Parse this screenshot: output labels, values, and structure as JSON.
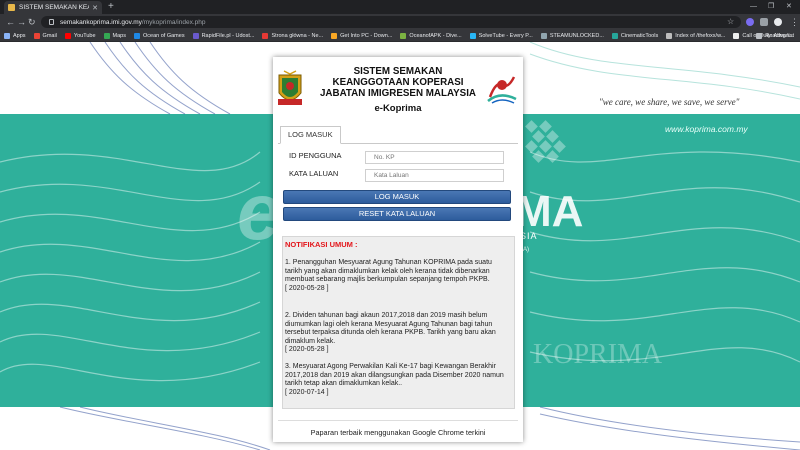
{
  "browser": {
    "tab_title": "SISTEM SEMAKAN KEANGGOTA...",
    "url_host": "semakankoprima.imi.gov.my",
    "url_path": "/mykoprima/index.php",
    "bookmarks": [
      "Apps",
      "Gmail",
      "YouTube",
      "Maps",
      "Ocean of Games",
      "RapidFile.pl - Udost...",
      "Strona główna - Ne...",
      "Get Into PC - Down...",
      "OceanofAPK - Dive...",
      "SolveTube - Every P...",
      "STEAMUNLOCKED...",
      "CinematicTools",
      "Index of /thefoxx/w...",
      "Call of Duty: Advan..."
    ],
    "reading_list": "Reading list"
  },
  "background": {
    "tagline": "\"we care, we share, we save, we serve\"",
    "site_url": "www.koprima.com.my"
  },
  "header": {
    "title_line1": "SISTEM SEMAKAN",
    "title_line2": "KEANGGOTAAN KOPERASI",
    "title_line3": "JABATAN IMIGRESEN MALAYSIA",
    "subtitle": "e-Koprima"
  },
  "login": {
    "tab_label": "LOG MASUK",
    "id_label": "ID PENGGUNA",
    "id_placeholder": "No. KP",
    "password_label": "KATA LALUAN",
    "password_placeholder": "Kata Laluan",
    "login_button": "LOG MASUK",
    "reset_button": "RESET KATA LALUAN"
  },
  "notices": {
    "heading": "NOTIFIKASI UMUM :",
    "items": [
      {
        "text": "1. Penangguhan Mesyuarat Agung Tahunan KOPRIMA pada suatu tarikh yang akan dimaklumkan kelak oleh kerana tidak dibenarkan membuat sebarang majlis berkumpulan sepanjang tempoh PKPB.",
        "date": "[ 2020-05-28 ]"
      },
      {
        "text": "2. Dividen tahunan bagi akaun 2017,2018 dan 2019 masih belum diumumkan lagi oleh kerana Mesyuarat Agung Tahunan bagi tahun tersebut terpaksa ditunda oleh kerana PKPB. Tarikh yang baru akan dimaklum kelak.",
        "date": "[ 2020-05-28 ]"
      },
      {
        "text": "3. Mesyuarat Agong Perwakilan Kali Ke-17 bagi Kewangan Berakhir 2017,2018 dan 2019 akan dilangsungkan pada Disember 2020 namun tarikh tetap akan dimaklumkan kelak..",
        "date": "[ 2020-07-14 ]"
      }
    ]
  },
  "footer": {
    "note": "Paparan terbaik menggunakan Google Chrome terkini"
  }
}
